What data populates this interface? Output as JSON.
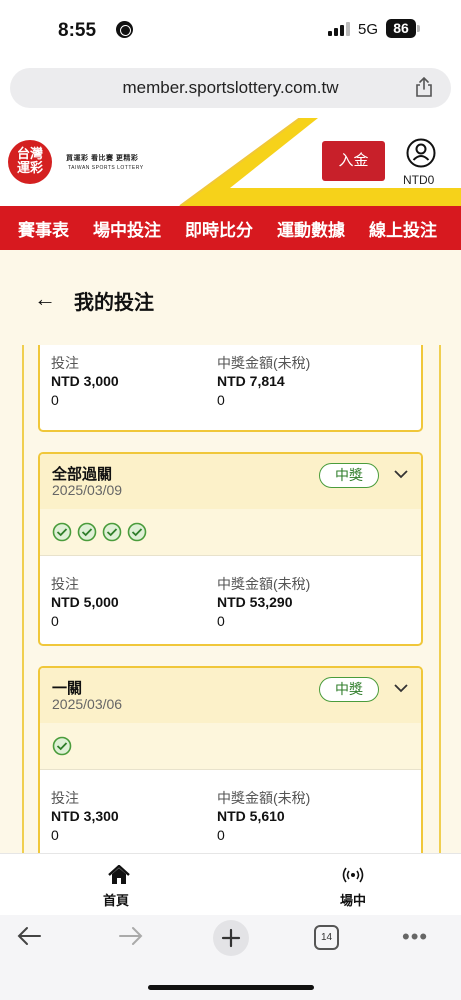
{
  "status_bar": {
    "time": "8:55",
    "network": "5G",
    "battery": "86"
  },
  "browser": {
    "url": "member.sportslottery.com.tw",
    "tab_count": "14"
  },
  "header": {
    "logo_text": "台灣\n運彩",
    "logo_tagline": "買運彩 看比賽 更精彩",
    "logo_english": "TAIWAN SPORTS LOTTERY",
    "deposit_label": "入金",
    "balance": "NTD0"
  },
  "nav": {
    "items": [
      {
        "label": "賽事表"
      },
      {
        "label": "場中投注"
      },
      {
        "label": "即時比分"
      },
      {
        "label": "運動數據"
      },
      {
        "label": "線上投注"
      }
    ]
  },
  "page": {
    "back": "←",
    "title": "我的投注"
  },
  "bets": [
    {
      "stake_label": "投注",
      "stake": "NTD 3,000",
      "stake_sub": "0",
      "payout_label": "中獎金額(未稅)",
      "payout": "NTD 7,814",
      "payout_sub": "0"
    },
    {
      "type": "全部過關",
      "date": "2025/03/09",
      "status": "中獎",
      "legs_won": 4,
      "stake_label": "投注",
      "stake": "NTD 5,000",
      "stake_sub": "0",
      "payout_label": "中獎金額(未稅)",
      "payout": "NTD 53,290",
      "payout_sub": "0"
    },
    {
      "type": "一關",
      "date": "2025/03/06",
      "status": "中獎",
      "legs_won": 1,
      "stake_label": "投注",
      "stake": "NTD 3,300",
      "stake_sub": "0",
      "payout_label": "中獎金額(未稅)",
      "payout": "NTD 5,610",
      "payout_sub": "0"
    }
  ],
  "tabbar": {
    "home_label": "首頁",
    "live_label": "場中"
  },
  "colors": {
    "brand_red": "#d7191f",
    "accent_yellow": "#f0c73a",
    "win_green": "#4a9c3c"
  }
}
